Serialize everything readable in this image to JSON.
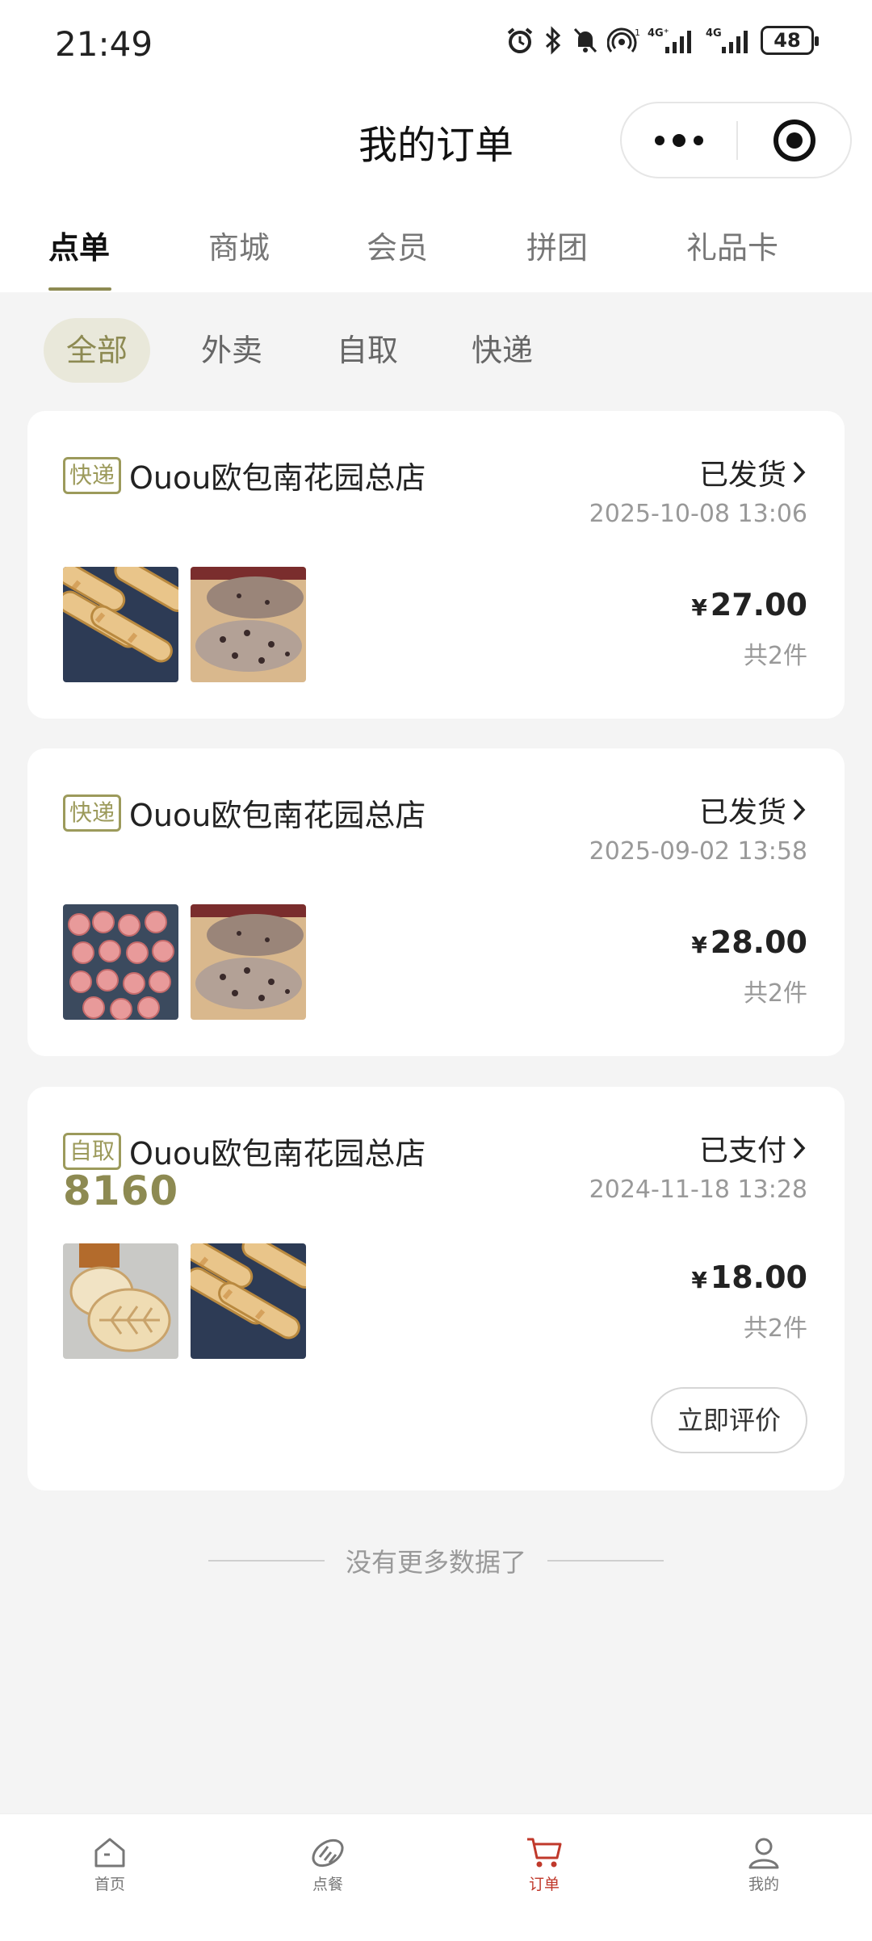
{
  "status_bar": {
    "time": "21:49",
    "battery": "48"
  },
  "header": {
    "title": "我的订单"
  },
  "tabs": [
    {
      "label": "点单",
      "active": true
    },
    {
      "label": "商城"
    },
    {
      "label": "会员"
    },
    {
      "label": "拼团"
    },
    {
      "label": "礼品卡"
    }
  ],
  "filters": [
    {
      "label": "全部",
      "active": true
    },
    {
      "label": "外卖"
    },
    {
      "label": "自取"
    },
    {
      "label": "快递"
    }
  ],
  "orders": [
    {
      "badge": "快递",
      "store": "Ouou欧包南花园总店",
      "status": "已发货",
      "date": "2025-10-08 13:06",
      "price_symbol": "¥",
      "price": "27.00",
      "count": "共2件"
    },
    {
      "badge": "快递",
      "store": "Ouou欧包南花园总店",
      "status": "已发货",
      "date": "2025-09-02 13:58",
      "price_symbol": "¥",
      "price": "28.00",
      "count": "共2件"
    },
    {
      "badge": "自取",
      "store": "Ouou欧包南花园总店",
      "status": "已支付",
      "date": "2024-11-18 13:28",
      "pickup_code": "8160",
      "price_symbol": "¥",
      "price": "18.00",
      "count": "共2件",
      "action": "立即评价"
    }
  ],
  "end_text": "没有更多数据了",
  "nav": [
    {
      "label": "首页",
      "icon": "home-icon"
    },
    {
      "label": "点餐",
      "icon": "bread-icon"
    },
    {
      "label": "订单",
      "icon": "cart-icon",
      "active": true
    },
    {
      "label": "我的",
      "icon": "user-icon"
    }
  ],
  "colors": {
    "accent": "#8d8a52",
    "active_nav": "#c0392b",
    "background": "#f4f4f4"
  }
}
